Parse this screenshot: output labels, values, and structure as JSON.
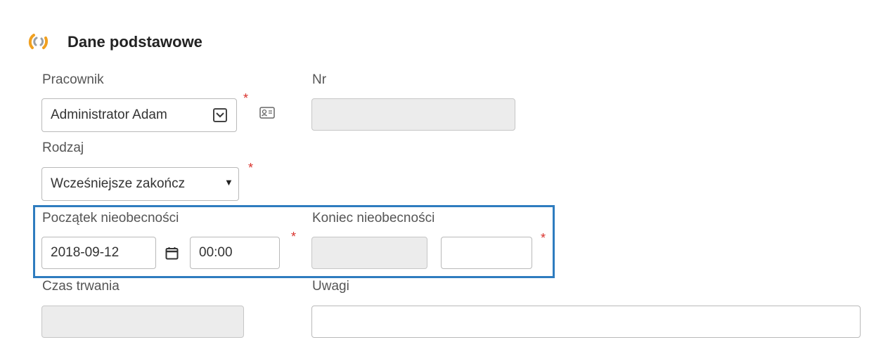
{
  "section": {
    "title": "Dane podstawowe",
    "icon": "spinner-arcs-icon",
    "icon_colors": [
      "#f0a020",
      "#9aa0a6"
    ]
  },
  "fields": {
    "pracownik": {
      "label": "Pracownik",
      "value": "Administrator Adam",
      "required_mark": "*"
    },
    "nr": {
      "label": "Nr",
      "value": ""
    },
    "rodzaj": {
      "label": "Rodzaj",
      "value": "Wcześniejsze zakończ",
      "required_mark": "*"
    },
    "poczatek": {
      "label": "Początek nieobecności",
      "date": "2018-09-12",
      "time": "00:00",
      "required_mark": "*"
    },
    "koniec": {
      "label": "Koniec nieobecności",
      "date": "",
      "time": "",
      "required_mark": "*"
    },
    "czas_trwania": {
      "label": "Czas trwania",
      "value": ""
    },
    "uwagi": {
      "label": "Uwagi",
      "value": ""
    }
  },
  "colors": {
    "required": "#d9312b",
    "highlight_border": "#2e7cbf",
    "disabled_bg": "#ececec"
  }
}
